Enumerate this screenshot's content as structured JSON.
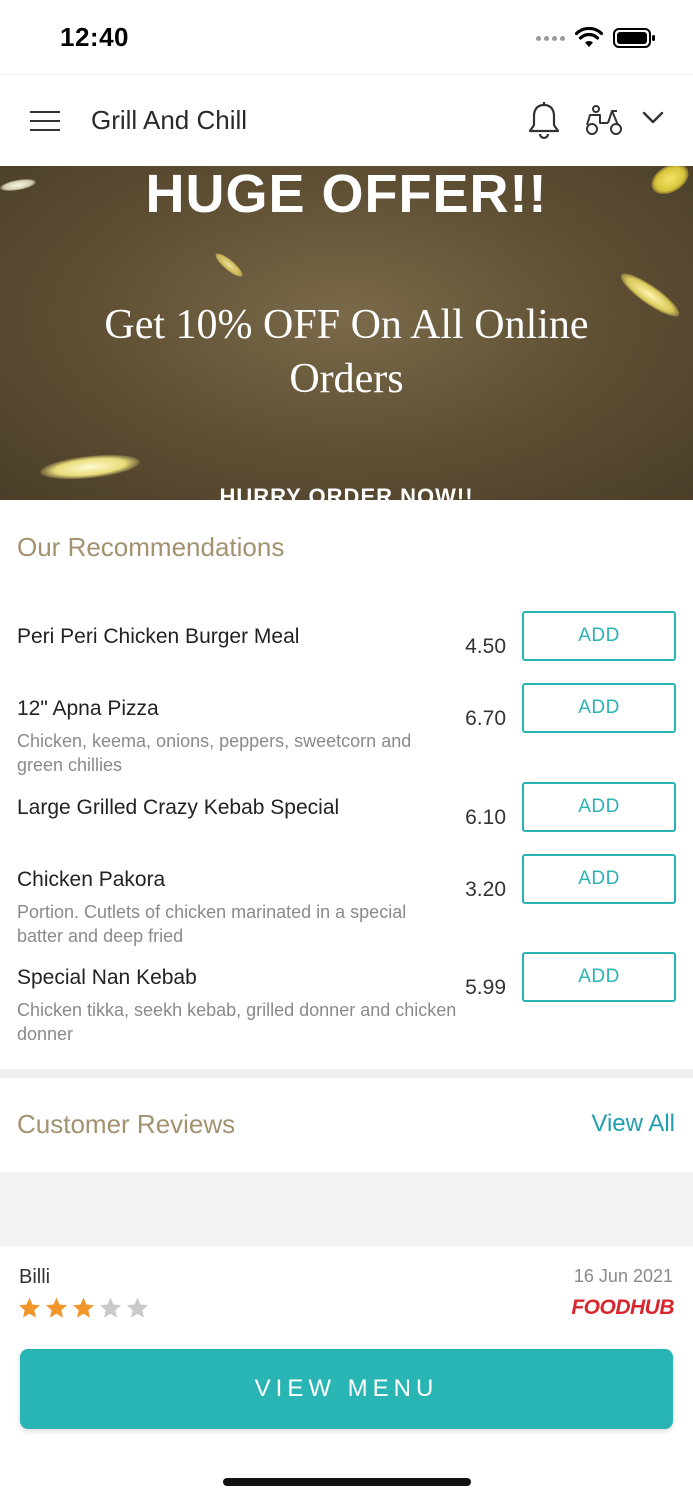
{
  "status_bar": {
    "time": "12:40"
  },
  "header": {
    "title": "Grill And Chill"
  },
  "banner": {
    "headline": "HUGE OFFER!!",
    "offer_line1": "Get 10% OFF On All Online",
    "offer_line2": "Orders",
    "cta": "HURRY ORDER NOW!!"
  },
  "recommendations": {
    "title": "Our Recommendations",
    "items": [
      {
        "name": "Peri Peri Chicken Burger Meal",
        "desc": "",
        "price": "4.50",
        "button": "ADD"
      },
      {
        "name": "12\" Apna Pizza",
        "desc": "Chicken, keema, onions, peppers, sweetcorn and green chillies",
        "price": "6.70",
        "button": "ADD"
      },
      {
        "name": "Large Grilled Crazy Kebab Special",
        "desc": "",
        "price": "6.10",
        "button": "ADD"
      },
      {
        "name": "Chicken Pakora",
        "desc": "Portion. Cutlets of chicken marinated in a special batter and deep fried",
        "price": "3.20",
        "button": "ADD"
      },
      {
        "name": "Special Nan Kebab",
        "desc": "Chicken tikka, seekh kebab, grilled donner and chicken donner",
        "price": "5.99",
        "button": "ADD"
      }
    ]
  },
  "reviews": {
    "title": "Customer Reviews",
    "view_all": "View All",
    "items": [
      {
        "name": "Billi",
        "date": "16 Jun 2021",
        "rating": 3,
        "max_rating": 5,
        "source": "FOODHUB"
      }
    ]
  },
  "footer": {
    "view_menu": "VIEW MENU"
  },
  "colors": {
    "accent": "#2ab5b5",
    "section_title": "#a39270",
    "link": "#1f9fb0",
    "star_filled": "#f0962a",
    "star_empty": "#c9c9c9",
    "foodhub": "#d8262c"
  }
}
